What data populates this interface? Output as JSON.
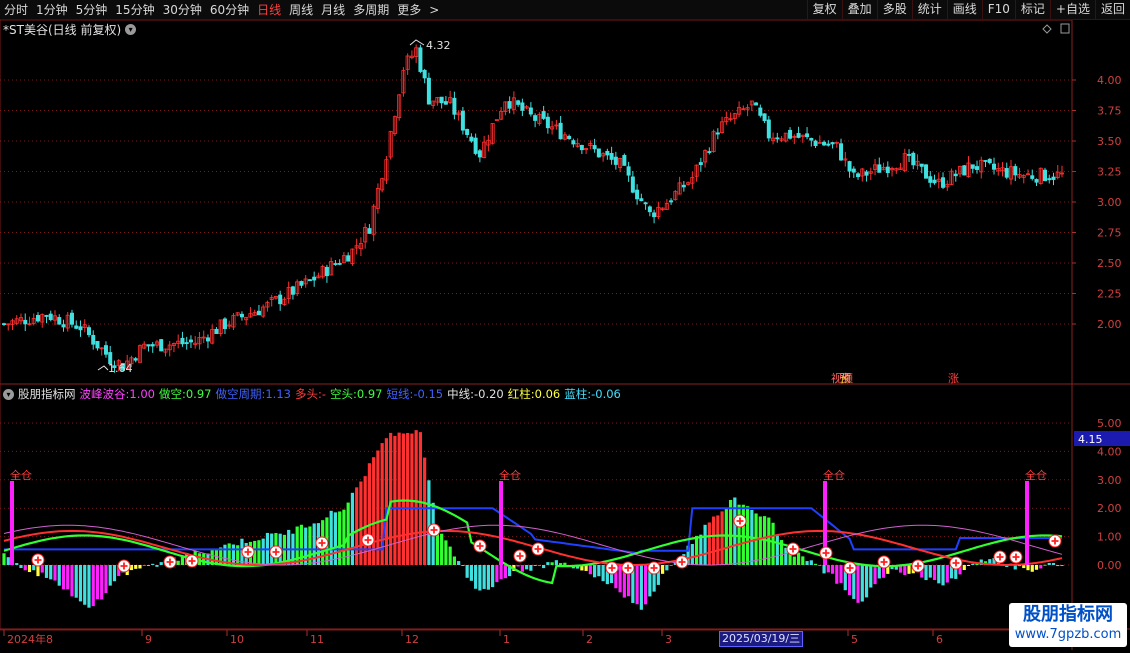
{
  "toolbar": {
    "periods": [
      "分时",
      "1分钟",
      "5分钟",
      "15分钟",
      "30分钟",
      "60分钟",
      "日线",
      "周线",
      "月线",
      "多周期",
      "更多"
    ],
    "active_period": "日线",
    "more_chevron": ">",
    "right_tools": [
      "复权",
      "叠加",
      "多股",
      "统计",
      "画线",
      "F10",
      "标记",
      "+自选",
      "返回"
    ]
  },
  "main_chart": {
    "title": "*ST美谷(日线 前复权)",
    "high_label": "4.32",
    "low_label": "1.64",
    "price_ticks": [
      "4.00",
      "3.75",
      "3.50",
      "3.25",
      "3.00",
      "2.75",
      "2.50",
      "2.25",
      "2.00"
    ],
    "tags": [
      {
        "text": "视频",
        "color": "#ff6060"
      },
      {
        "text": "涨",
        "color": "#ff4040"
      }
    ],
    "tag_overlap": "预"
  },
  "indicator": {
    "name": "股朋指标网",
    "fields": [
      {
        "label": "波峰波谷:",
        "value": "1.00",
        "color": "#ff40ff"
      },
      {
        "label": "做空:",
        "value": "0.97",
        "color": "#40ff40"
      },
      {
        "label": "做空周期:",
        "value": "1.13",
        "color": "#4060ff"
      },
      {
        "label": "多头:",
        "value": "-",
        "color": "#ff4040"
      },
      {
        "label": "空头:",
        "value": "0.97",
        "color": "#40ff40"
      },
      {
        "label": "短线:",
        "value": "-0.15",
        "color": "#4060ff"
      },
      {
        "label": "中线:",
        "value": "-0.20",
        "color": "#e0e0e0"
      },
      {
        "label": "红柱:",
        "value": "0.06",
        "color": "#ffff40"
      },
      {
        "label": "蓝柱:",
        "value": "-0.06",
        "color": "#40e0ff"
      }
    ],
    "value_ticks": [
      "5.00",
      "4.00",
      "3.00",
      "2.00",
      "1.00",
      "0.00"
    ],
    "current_value": "4.15",
    "signal_label": "全仓"
  },
  "x_axis": {
    "labels": [
      "2024年8",
      "9",
      "10",
      "11",
      "12",
      "1",
      "2",
      "3",
      "4",
      "5",
      "6"
    ],
    "cursor_date": "2025/03/19/三"
  },
  "watermark": {
    "name": "股朋指标网",
    "url": "www.7gpzb.com"
  },
  "colors": {
    "up": "#ff3030",
    "down": "#40e0e0",
    "magenta": "#ff20ff",
    "blue": "#2040ff",
    "green": "#30ff30",
    "grid": "#7a1a1a"
  }
}
